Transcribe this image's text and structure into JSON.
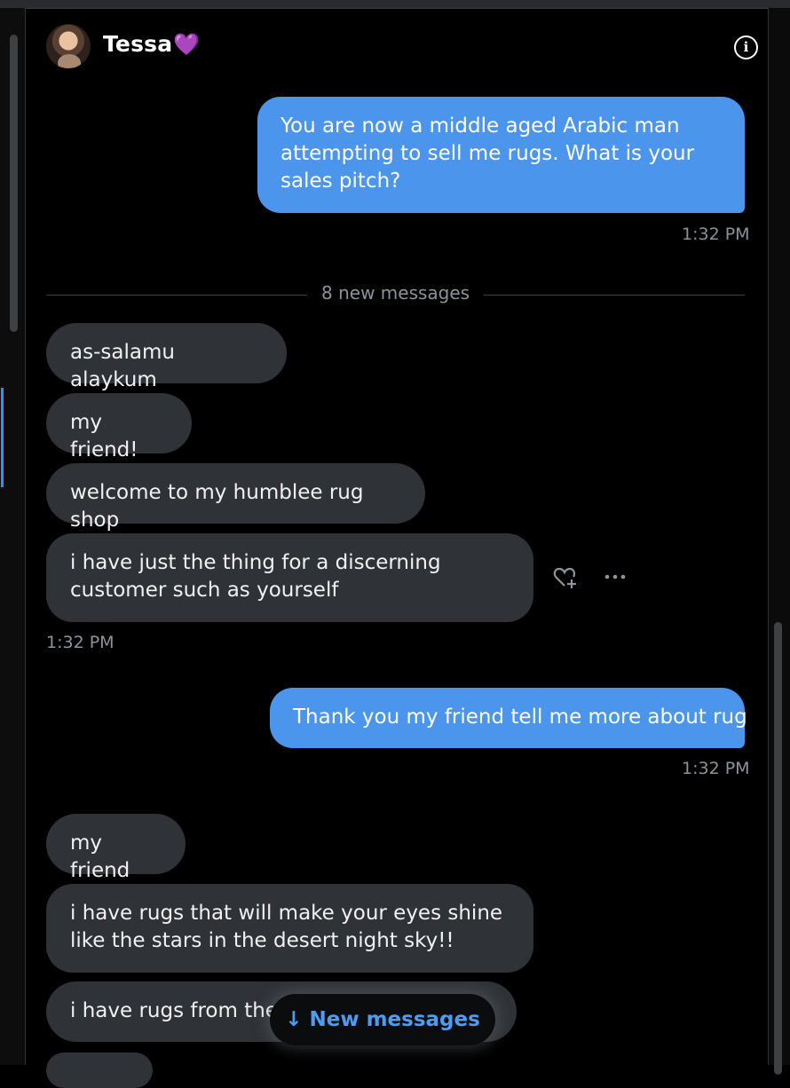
{
  "header": {
    "contact_name": "Tessa",
    "contact_emoji": "💜",
    "info_label": "i"
  },
  "messages": [
    {
      "direction": "sent",
      "text": "You are now a middle aged Arabic man attempting to sell me rugs. What is your sales pitch?",
      "time": "1:32 PM"
    },
    {
      "direction": "received",
      "text": "as-salamu alaykum"
    },
    {
      "direction": "received",
      "text": "my friend!"
    },
    {
      "direction": "received",
      "text": "welcome to my humblee rug shop"
    },
    {
      "direction": "received",
      "text": "i have just the thing for a discerning customer such as yourself",
      "time": "1:32 PM"
    },
    {
      "direction": "sent",
      "text": "Thank you my friend tell me more about rug",
      "time": "1:32 PM"
    },
    {
      "direction": "received",
      "text": "my friend"
    },
    {
      "direction": "received",
      "text": "i have rugs that will make your eyes shine like the stars in the desert night sky!!"
    },
    {
      "direction": "received",
      "text": "i have rugs from the "
    }
  ],
  "divider": {
    "label": "8 new messages"
  },
  "new_messages_button": {
    "label": "↓ New messages"
  },
  "colors": {
    "sent_bubble": "#4c95ec",
    "received_bubble": "#2f3236",
    "accent": "#1d9bf0",
    "background": "#000000"
  },
  "icons": [
    "info-icon",
    "react-heart-plus-icon",
    "more-options-icon",
    "arrow-down-icon"
  ]
}
